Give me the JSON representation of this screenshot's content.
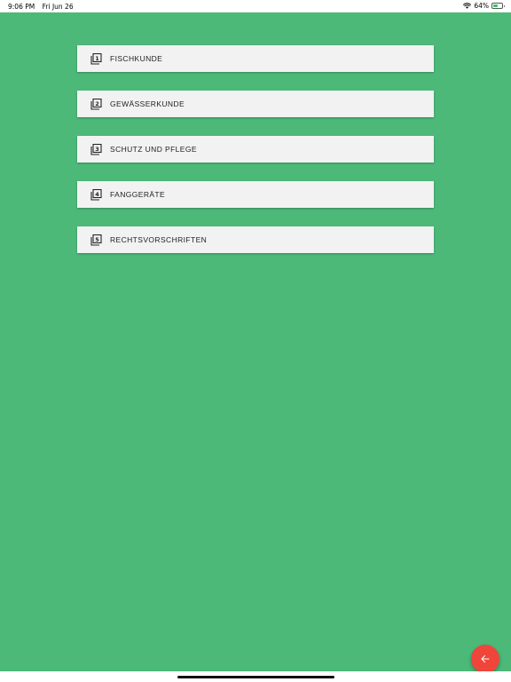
{
  "status_bar": {
    "time": "9:06 PM",
    "date": "Fri Jun 26",
    "battery_percent": "64%",
    "battery_level": 0.64,
    "icons": [
      "wifi-icon",
      "battery-icon"
    ]
  },
  "colors": {
    "background_green": "#4cb979",
    "card_background": "#f2f2f2",
    "fab_red": "#f0453a",
    "battery_green": "#34c759"
  },
  "menu": {
    "items": [
      {
        "number": "1",
        "label": "FISCHKUNDE",
        "icon": "library-book-1-icon"
      },
      {
        "number": "2",
        "label": "GEWÄSSERKUNDE",
        "icon": "library-book-2-icon"
      },
      {
        "number": "3",
        "label": "SCHUTZ UND PFLEGE",
        "icon": "library-book-3-icon"
      },
      {
        "number": "4",
        "label": "FANGGERÄTE",
        "icon": "library-book-4-icon"
      },
      {
        "number": "5",
        "label": "RECHTSVORSCHRIFTEN",
        "icon": "library-book-5-icon"
      }
    ]
  },
  "fab": {
    "icon": "arrow-left-icon"
  }
}
